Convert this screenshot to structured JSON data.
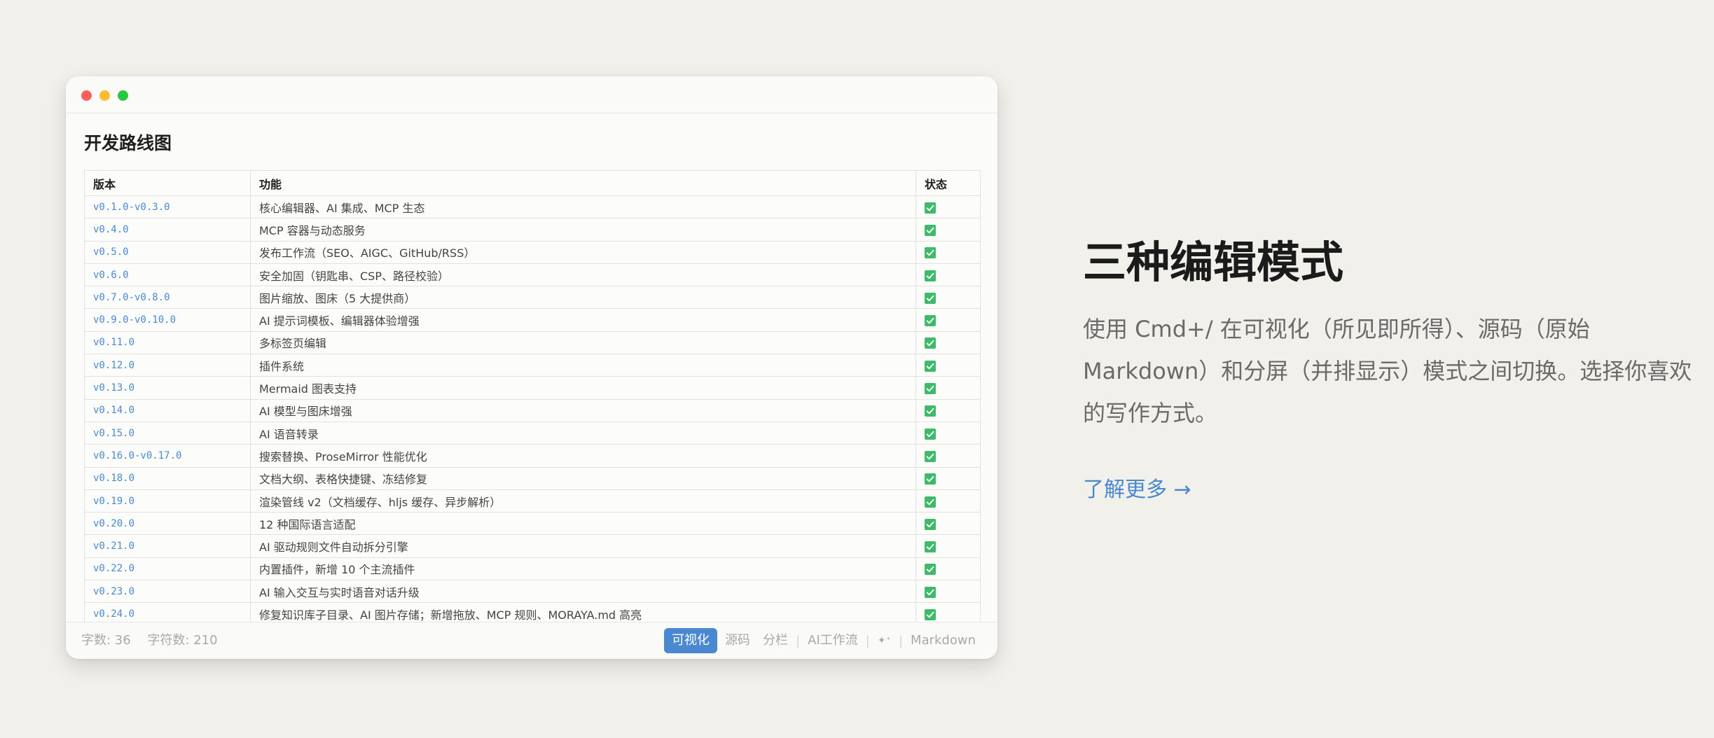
{
  "window": {
    "traffic_lights": [
      "#fe5f57",
      "#febc2e",
      "#28c840"
    ]
  },
  "document": {
    "title": "开发路线图",
    "table": {
      "headers": [
        "版本",
        "功能",
        "状态"
      ],
      "rows": [
        {
          "version": "v0.1.0-v0.3.0",
          "feature": "核心编辑器、AI 集成、MCP 生态",
          "done": true
        },
        {
          "version": "v0.4.0",
          "feature": "MCP 容器与动态服务",
          "done": true
        },
        {
          "version": "v0.5.0",
          "feature": "发布工作流（SEO、AIGC、GitHub/RSS）",
          "done": true
        },
        {
          "version": "v0.6.0",
          "feature": "安全加固（钥匙串、CSP、路径校验）",
          "done": true
        },
        {
          "version": "v0.7.0-v0.8.0",
          "feature": "图片缩放、图床（5 大提供商）",
          "done": true
        },
        {
          "version": "v0.9.0-v0.10.0",
          "feature": "AI 提示词模板、编辑器体验增强",
          "done": true
        },
        {
          "version": "v0.11.0",
          "feature": "多标签页编辑",
          "done": true
        },
        {
          "version": "v0.12.0",
          "feature": "插件系统",
          "done": true
        },
        {
          "version": "v0.13.0",
          "feature": "Mermaid 图表支持",
          "done": true
        },
        {
          "version": "v0.14.0",
          "feature": "AI 模型与图床增强",
          "done": true
        },
        {
          "version": "v0.15.0",
          "feature": "AI 语音转录",
          "done": true
        },
        {
          "version": "v0.16.0-v0.17.0",
          "feature": "搜索替换、ProseMirror 性能优化",
          "done": true
        },
        {
          "version": "v0.18.0",
          "feature": "文档大纲、表格快捷键、冻结修复",
          "done": true
        },
        {
          "version": "v0.19.0",
          "feature": "渲染管线 v2（文档缓存、hljs 缓存、异步解析）",
          "done": true
        },
        {
          "version": "v0.20.0",
          "feature": "12 种国际语言适配",
          "done": true
        },
        {
          "version": "v0.21.0",
          "feature": "AI 驱动规则文件自动拆分引擎",
          "done": true
        },
        {
          "version": "v0.22.0",
          "feature": "内置插件，新增 10 个主流插件",
          "done": true
        },
        {
          "version": "v0.23.0",
          "feature": "AI 输入交互与实时语音对话升级",
          "done": true
        },
        {
          "version": "v0.24.0",
          "feature": "修复知识库子目录、AI 图片存储；新增拖放、MCP 规则、MORAYA.md 高亮",
          "done": true
        }
      ]
    }
  },
  "statusbar": {
    "word_count": "字数: 36",
    "char_count": "字符数: 210",
    "modes": {
      "visual": "可视化",
      "source": "源码",
      "split": "分栏",
      "ai_workflow": "AI工作流",
      "sparkle": "✦⁺",
      "markdown": "Markdown"
    },
    "separator": "|"
  },
  "hero": {
    "title": "三种编辑模式",
    "description": "使用 Cmd+/ 在可视化（所见即所得）、源码（原始 Markdown）和分屏（并排显示）模式之间切换。选择你喜欢的写作方式。",
    "link": "了解更多 →"
  },
  "colors": {
    "accent": "#4a88cf",
    "check": "#3fb96a",
    "background": "#f1f0eb"
  }
}
